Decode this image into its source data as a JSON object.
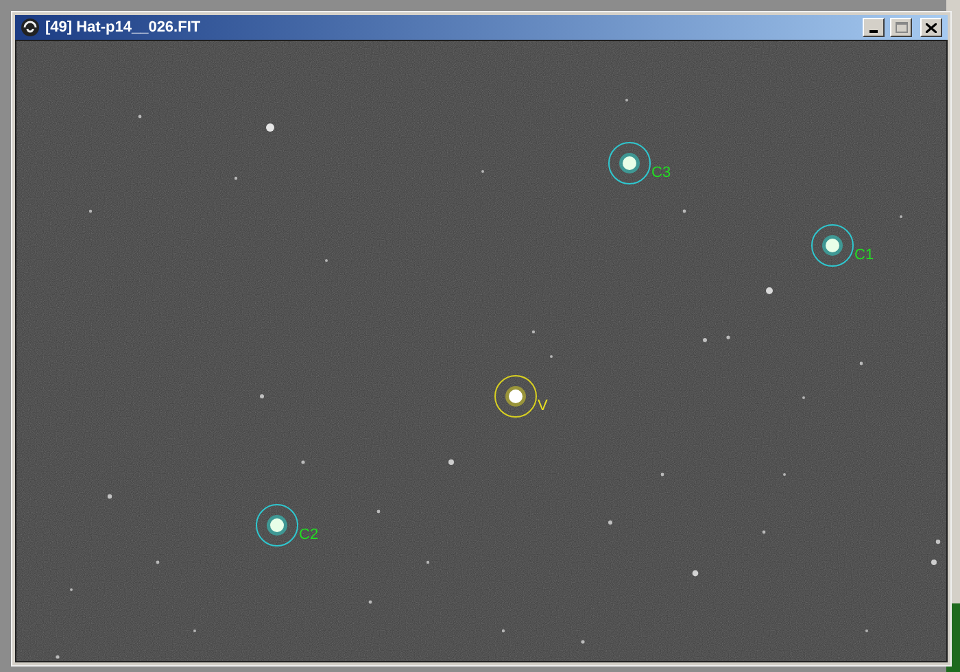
{
  "window": {
    "title": "[49] Hat-p14__026.FIT"
  },
  "apertures": [
    {
      "label": "C3",
      "kind": "comparison"
    },
    {
      "label": "C1",
      "kind": "comparison"
    },
    {
      "label": "V",
      "kind": "variable"
    },
    {
      "label": "C2",
      "kind": "comparison"
    }
  ]
}
